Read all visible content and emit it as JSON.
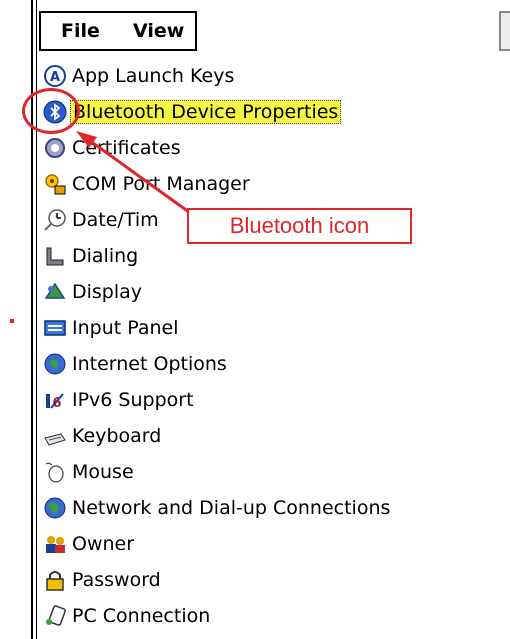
{
  "menu": {
    "file": "File",
    "view": "View"
  },
  "items": [
    {
      "label": "App Launch Keys",
      "icon": "app-launch-icon"
    },
    {
      "label": "Bluetooth Device Properties",
      "icon": "bluetooth-icon",
      "selected": true
    },
    {
      "label": "Certificates",
      "icon": "certificates-icon"
    },
    {
      "label": "COM Port Manager",
      "icon": "com-port-icon"
    },
    {
      "label": "Date/Tim",
      "icon": "date-time-icon"
    },
    {
      "label": "Dialing",
      "icon": "dialing-icon"
    },
    {
      "label": "Display",
      "icon": "display-icon"
    },
    {
      "label": "Input Panel",
      "icon": "input-panel-icon"
    },
    {
      "label": "Internet Options",
      "icon": "internet-options-icon"
    },
    {
      "label": "IPv6 Support",
      "icon": "ipv6-icon"
    },
    {
      "label": "Keyboard",
      "icon": "keyboard-icon"
    },
    {
      "label": "Mouse",
      "icon": "mouse-icon"
    },
    {
      "label": "Network and Dial-up Connections",
      "icon": "network-icon"
    },
    {
      "label": "Owner",
      "icon": "owner-icon"
    },
    {
      "label": "Password",
      "icon": "password-icon"
    },
    {
      "label": "PC Connection",
      "icon": "pc-connection-icon"
    }
  ],
  "annotation": {
    "text": "Bluetooth icon",
    "color": "#e0262b"
  },
  "colors": {
    "selection_highlight": "#f5f542"
  }
}
